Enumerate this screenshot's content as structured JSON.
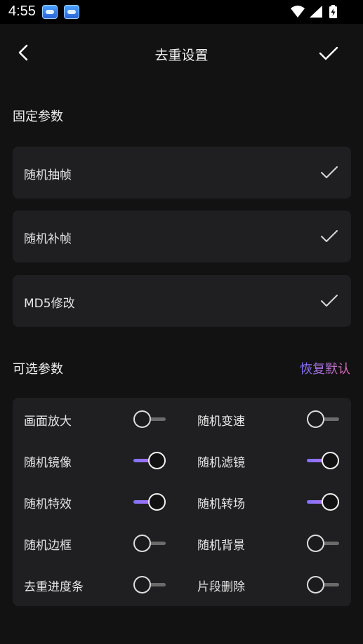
{
  "status_bar": {
    "time": "4:55",
    "icons": [
      "app-notification-icon",
      "app-notification-icon",
      "wifi-icon",
      "signal-icon",
      "battery-charging-icon"
    ]
  },
  "header": {
    "title": "去重设置",
    "back_icon": "chevron-left-icon",
    "confirm_icon": "check-icon"
  },
  "fixed_section": {
    "title": "固定参数",
    "items": [
      {
        "label": "随机抽帧",
        "checked": true
      },
      {
        "label": "随机补帧",
        "checked": true
      },
      {
        "label": "MD5修改",
        "checked": true
      }
    ]
  },
  "optional_section": {
    "title": "可选参数",
    "restore_label": "恢复默认",
    "options": [
      {
        "label": "画面放大",
        "on": false
      },
      {
        "label": "随机变速",
        "on": false
      },
      {
        "label": "随机镜像",
        "on": true
      },
      {
        "label": "随机滤镜",
        "on": true
      },
      {
        "label": "随机特效",
        "on": true
      },
      {
        "label": "随机转场",
        "on": true
      },
      {
        "label": "随机边框",
        "on": false
      },
      {
        "label": "随机背景",
        "on": false
      },
      {
        "label": "去重进度条",
        "on": false
      },
      {
        "label": "片段删除",
        "on": false
      }
    ]
  },
  "colors": {
    "background": "#121212",
    "card": "#1f1f21",
    "accent_start": "#7f73ff",
    "accent_end": "#e66ab5"
  }
}
